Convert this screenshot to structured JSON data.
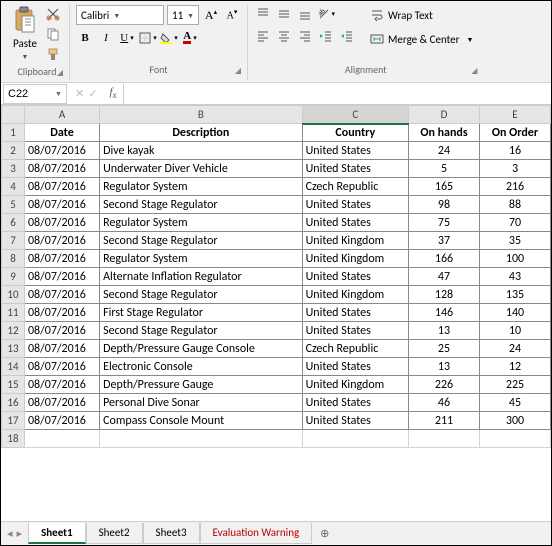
{
  "ribbon": {
    "clipboard": {
      "paste": "Paste",
      "label": "Clipboard"
    },
    "font": {
      "name": "Calibri",
      "size": "11",
      "label": "Font"
    },
    "alignment": {
      "wrap": "Wrap Text",
      "merge": "Merge & Center",
      "label": "Alignment"
    }
  },
  "namebox": "C22",
  "headers": [
    "Date",
    "Description",
    "Country",
    "On hands",
    "On Order"
  ],
  "rows": [
    [
      "08/07/2016",
      "Dive kayak",
      "United States",
      "24",
      "16"
    ],
    [
      "08/07/2016",
      "Underwater Diver Vehicle",
      "United States",
      "5",
      "3"
    ],
    [
      "08/07/2016",
      "Regulator System",
      "Czech Republic",
      "165",
      "216"
    ],
    [
      "08/07/2016",
      "Second Stage Regulator",
      "United States",
      "98",
      "88"
    ],
    [
      "08/07/2016",
      "Regulator System",
      "United States",
      "75",
      "70"
    ],
    [
      "08/07/2016",
      "Second Stage Regulator",
      "United Kingdom",
      "37",
      "35"
    ],
    [
      "08/07/2016",
      "Regulator System",
      "United Kingdom",
      "166",
      "100"
    ],
    [
      "08/07/2016",
      "Alternate Inflation Regulator",
      "United States",
      "47",
      "43"
    ],
    [
      "08/07/2016",
      "Second Stage Regulator",
      "United Kingdom",
      "128",
      "135"
    ],
    [
      "08/07/2016",
      "First Stage Regulator",
      "United States",
      "146",
      "140"
    ],
    [
      "08/07/2016",
      "Second Stage Regulator",
      "United States",
      "13",
      "10"
    ],
    [
      "08/07/2016",
      "Depth/Pressure Gauge Console",
      "Czech Republic",
      "25",
      "24"
    ],
    [
      "08/07/2016",
      "Electronic Console",
      "United States",
      "13",
      "12"
    ],
    [
      "08/07/2016",
      "Depth/Pressure Gauge",
      "United Kingdom",
      "226",
      "225"
    ],
    [
      "08/07/2016",
      "Personal Dive Sonar",
      "United States",
      "46",
      "45"
    ],
    [
      "08/07/2016",
      "Compass Console Mount",
      "United States",
      "211",
      "300"
    ]
  ],
  "columns": [
    "A",
    "B",
    "C",
    "D",
    "E"
  ],
  "tabs": {
    "sheets": [
      "Sheet1",
      "Sheet2",
      "Sheet3"
    ],
    "warning": "Evaluation Warning",
    "active": "Sheet1"
  }
}
